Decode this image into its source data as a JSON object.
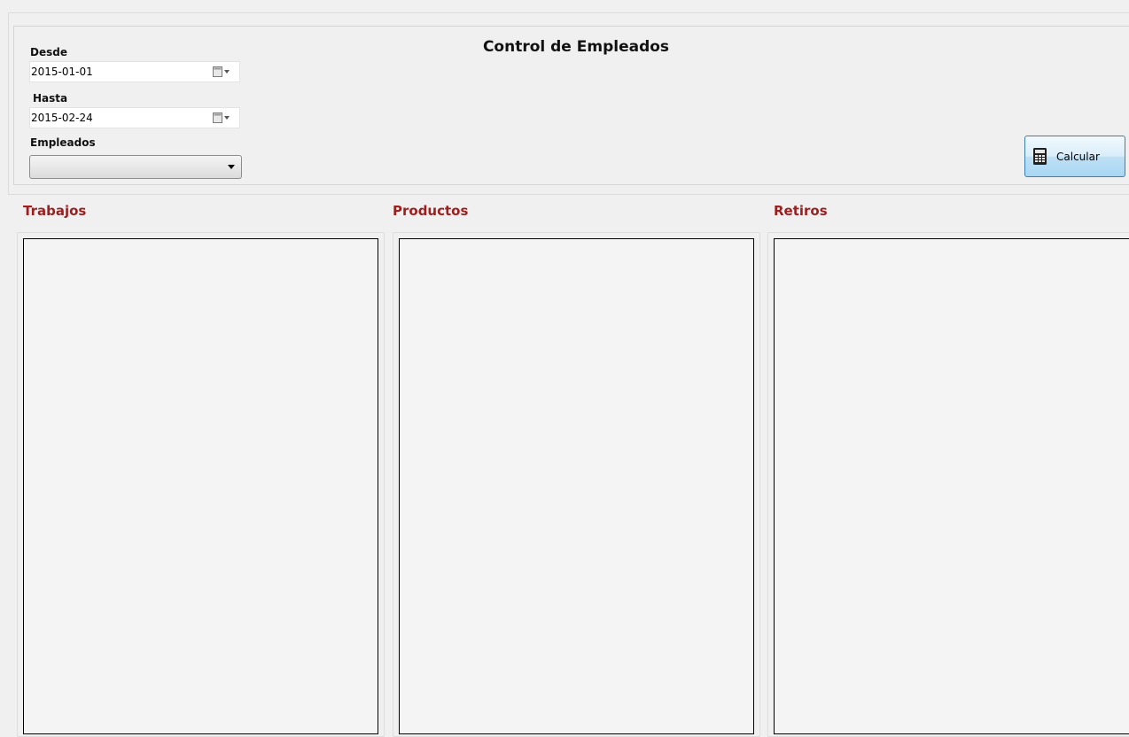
{
  "title": "Control de Empleados",
  "filters": {
    "desde_label": "Desde",
    "desde_value": "2015-01-01",
    "hasta_label": "Hasta",
    "hasta_value": "2015-02-24",
    "empleados_label": "Empleados",
    "empleados_value": ""
  },
  "actions": {
    "calcular_label": "Calcular"
  },
  "sections": {
    "trabajos": "Trabajos",
    "productos": "Productos",
    "retiros": "Retiros"
  },
  "colors": {
    "section_title": "#9c1f1f",
    "button_border": "#3c7fb1"
  },
  "icons": {
    "date_picker": "calendar-dropdown-icon",
    "calcular": "calculator-icon"
  }
}
